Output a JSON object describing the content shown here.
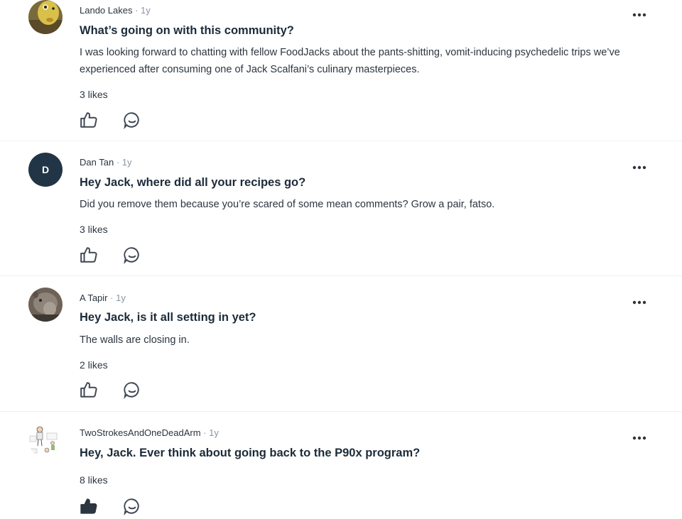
{
  "posts": [
    {
      "author": "Lando Lakes",
      "separator": "·",
      "age": "1y",
      "title": "What’s going on with this community?",
      "body": "I was looking forward to chatting with fellow FoodJacks about the pants-shitting, vomit-inducing psychedelic trips we’ve experienced after consuming one of Jack Scalfani’s culinary masterpieces.",
      "likes": "3 likes",
      "avatar": "photo-face-icon"
    },
    {
      "author": "Dan Tan",
      "separator": "·",
      "age": "1y",
      "title": "Hey Jack, where did all your recipes go?",
      "body": "Did you remove them because you’re scared of some mean comments? Grow a pair, fatso.",
      "likes": "3 likes",
      "avatar_initial": "D"
    },
    {
      "author": "A Tapir",
      "separator": "·",
      "age": "1y",
      "title": "Hey Jack, is it all setting in yet?",
      "body": "The walls are closing in.",
      "likes": "2 likes",
      "avatar": "tapir-photo-icon"
    },
    {
      "author": "TwoStrokesAndOneDeadArm",
      "separator": "·",
      "age": "1y",
      "title": "Hey, Jack. Ever think about going back to the P90x program?",
      "body": "",
      "likes": "8 likes",
      "avatar": "sketch-avatar-icon"
    }
  ],
  "icons": {
    "like": "thumbs-up-icon",
    "comment": "comment-bubble-icon",
    "more": "more-options-icon"
  },
  "colors": {
    "title": "#1c2b39",
    "initial_avatar_bg": "#213547",
    "icon": "#3d4752",
    "divider": "#eef0f2"
  }
}
